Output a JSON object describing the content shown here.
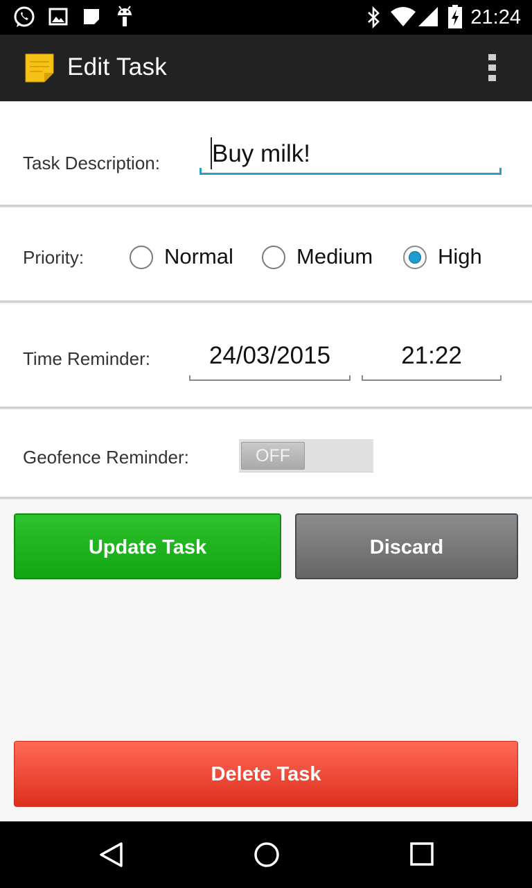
{
  "status_bar": {
    "time": "21:24",
    "left_icons": [
      "whatsapp-icon",
      "image-icon",
      "note-icon",
      "android-icon"
    ],
    "right_icons": [
      "bluetooth-icon",
      "wifi-icon",
      "signal-icon",
      "battery-charging-icon"
    ]
  },
  "action_bar": {
    "title": "Edit Task",
    "app_icon": "sticky-note-icon",
    "overflow_icon": "overflow-menu-icon"
  },
  "task_description": {
    "label": "Task Description:",
    "value": "Buy milk!"
  },
  "priority": {
    "label": "Priority:",
    "options": [
      {
        "label": "Normal",
        "checked": false
      },
      {
        "label": "Medium",
        "checked": false
      },
      {
        "label": "High",
        "checked": true
      }
    ],
    "accent": "#1f9bd2"
  },
  "time_reminder": {
    "label": "Time Reminder:",
    "date": "24/03/2015",
    "time": "21:22"
  },
  "geofence": {
    "label": "Geofence Reminder:",
    "switch_text": "OFF",
    "enabled": false
  },
  "buttons": {
    "update": "Update Task",
    "discard": "Discard",
    "delete": "Delete Task",
    "colors": {
      "update": "#1eb31e",
      "discard": "#7a7a7a",
      "delete": "#f04a36"
    }
  },
  "nav_bar": {
    "icons": [
      "back-icon",
      "home-icon",
      "recents-icon"
    ]
  }
}
